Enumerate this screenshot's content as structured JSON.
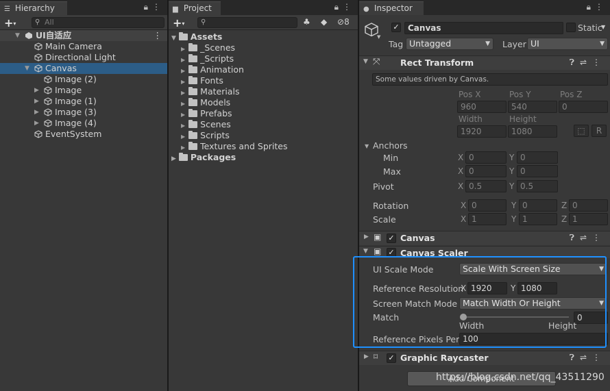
{
  "hierarchy": {
    "tab_title": "Hierarchy",
    "search_placeholder": "All",
    "items": [
      {
        "label": "UI自适应",
        "depth": 0,
        "scene": true
      },
      {
        "label": "Main Camera",
        "depth": 1
      },
      {
        "label": "Directional Light",
        "depth": 1
      },
      {
        "label": "Canvas",
        "depth": 1,
        "selected": true,
        "expanded": true
      },
      {
        "label": "Image (2)",
        "depth": 2
      },
      {
        "label": "Image",
        "depth": 2
      },
      {
        "label": "Image (1)",
        "depth": 2
      },
      {
        "label": "Image (3)",
        "depth": 2
      },
      {
        "label": "Image (4)",
        "depth": 2
      },
      {
        "label": "EventSystem",
        "depth": 1
      }
    ]
  },
  "project": {
    "tab_title": "Project",
    "hidden_count": "8",
    "assets_label": "Assets",
    "folders": [
      "_Scenes",
      "_Scripts",
      "Animation",
      "Fonts",
      "Materials",
      "Models",
      "Prefabs",
      "Scenes",
      "Scripts",
      "Textures and Sprites"
    ],
    "packages_label": "Packages"
  },
  "inspector": {
    "tab_title": "Inspector",
    "object_name": "Canvas",
    "static_label": "Static",
    "tag_label": "Tag",
    "tag_value": "Untagged",
    "layer_label": "Layer",
    "layer_value": "UI",
    "rect_transform": {
      "title": "Rect Transform",
      "note": "Some values driven by Canvas.",
      "pos_x_label": "Pos X",
      "pos_y_label": "Pos Y",
      "pos_z_label": "Pos Z",
      "pos_x": "960",
      "pos_y": "540",
      "pos_z": "0",
      "width_label": "Width",
      "height_label": "Height",
      "width": "1920",
      "height": "1080",
      "anchors_label": "Anchors",
      "min_label": "Min",
      "min_x": "0",
      "min_y": "0",
      "max_label": "Max",
      "max_x": "0",
      "max_y": "0",
      "pivot_label": "Pivot",
      "pivot_x": "0.5",
      "pivot_y": "0.5",
      "rotation_label": "Rotation",
      "rot_x": "0",
      "rot_y": "0",
      "rot_z": "0",
      "scale_label": "Scale",
      "scale_x": "1",
      "scale_y": "1",
      "scale_z": "1",
      "r_button": "R"
    },
    "canvas_comp": {
      "title": "Canvas"
    },
    "canvas_scaler": {
      "title": "Canvas Scaler",
      "ui_scale_mode_label": "UI Scale Mode",
      "ui_scale_mode": "Scale With Screen Size",
      "ref_res_label": "Reference Resolution",
      "ref_x": "1920",
      "ref_y": "1080",
      "match_mode_label": "Screen Match Mode",
      "match_mode": "Match Width Or Height",
      "match_label": "Match",
      "match_value": "0",
      "width_hint": "Width",
      "height_hint": "Height",
      "ppu_label": "Reference Pixels Per Unit",
      "ppu_value": "100"
    },
    "graphic_raycaster": {
      "title": "Graphic Raycaster"
    },
    "add_component": "Add Component",
    "axis": {
      "x": "X",
      "y": "Y",
      "z": "Z"
    }
  },
  "watermark": "https://blog.csdn.net/qq_43511290",
  "colors": {
    "selection": "#2c5d87",
    "highlight": "#1e90ff",
    "panel": "#383838"
  }
}
